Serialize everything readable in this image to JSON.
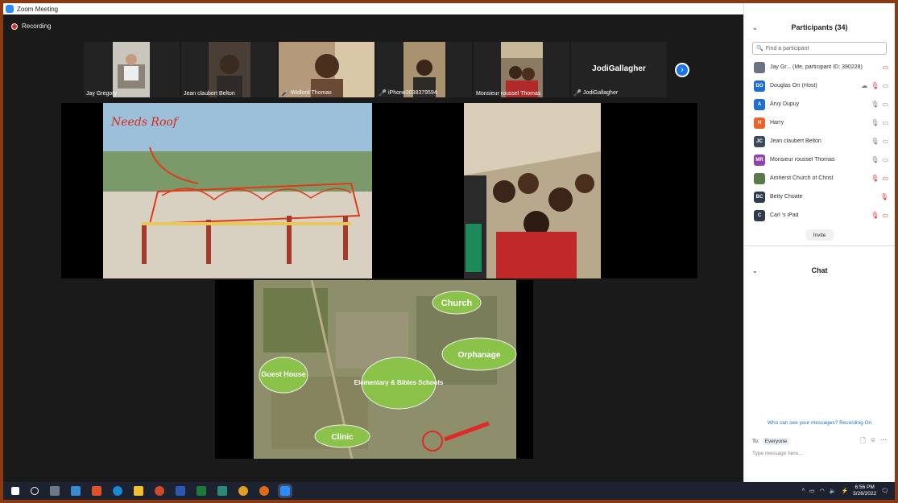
{
  "window": {
    "title": "Zoom Meeting",
    "controls": [
      "–",
      "❐",
      "✕"
    ]
  },
  "meeting": {
    "recording_label": "Recording",
    "thumbnails": [
      {
        "name": "Jay Gregory",
        "muted": false
      },
      {
        "name": "Jean claubert Belton",
        "muted": false
      },
      {
        "name": "Widlord Thomas",
        "muted": true
      },
      {
        "name": "iPhone2038379594",
        "muted": true
      },
      {
        "name": "Monsieur roussel Thomas",
        "muted": false
      },
      {
        "name": "JodiGallagher",
        "muted": true,
        "display_name": "JodiGallagher"
      }
    ],
    "slides": {
      "roof_text": "Needs Roof",
      "map_labels": [
        "Church",
        "Guest House",
        "Elementary & Bibles Schools",
        "Orphanage",
        "Clinic"
      ]
    }
  },
  "participants": {
    "header": "Participants (34)",
    "search_placeholder": "Find a participant",
    "list": [
      {
        "initials": "",
        "name": "Jay Gr...  (Me, participant ID: 390228)",
        "color": "#6b7280",
        "icons": [
          "vid-off"
        ]
      },
      {
        "initials": "DO",
        "name": "Douglas Orr (Host)",
        "color": "#1f6fd0",
        "icons": [
          "cloud",
          "mic-off",
          "vid"
        ]
      },
      {
        "initials": "A",
        "name": "Arvy Dupuy",
        "color": "#1f6fd0",
        "icons": [
          "mic",
          "vid"
        ]
      },
      {
        "initials": "H",
        "name": "Harry",
        "color": "#e8642a",
        "icons": [
          "mic",
          "vid"
        ]
      },
      {
        "initials": "JC",
        "name": "Jean claubert Belton",
        "color": "#3c4a5c",
        "icons": [
          "mic",
          "vid"
        ]
      },
      {
        "initials": "MR",
        "name": "Monsieur roussel Thomas",
        "color": "#8e44ad",
        "icons": [
          "mic",
          "vid"
        ]
      },
      {
        "initials": "",
        "name": "Amherst Church of Christ",
        "color": "#5a7a4a",
        "icons": [
          "mic-off",
          "vid-off"
        ]
      },
      {
        "initials": "BC",
        "name": "Betty Choate",
        "color": "#2f3b4c",
        "icons": [
          "mic-off"
        ]
      },
      {
        "initials": "C",
        "name": "Carl 's iPad",
        "color": "#2f3b4c",
        "icons": [
          "mic-off",
          "vid-off"
        ]
      }
    ],
    "invite_label": "Invite"
  },
  "chat": {
    "header": "Chat",
    "visibility_note": "Who can see your messages? Recording On",
    "to_label": "To:",
    "to_value": "Everyone",
    "input_placeholder": "Type message here..."
  },
  "taskbar": {
    "time": "6:56 PM",
    "date": "5/26/2022"
  }
}
